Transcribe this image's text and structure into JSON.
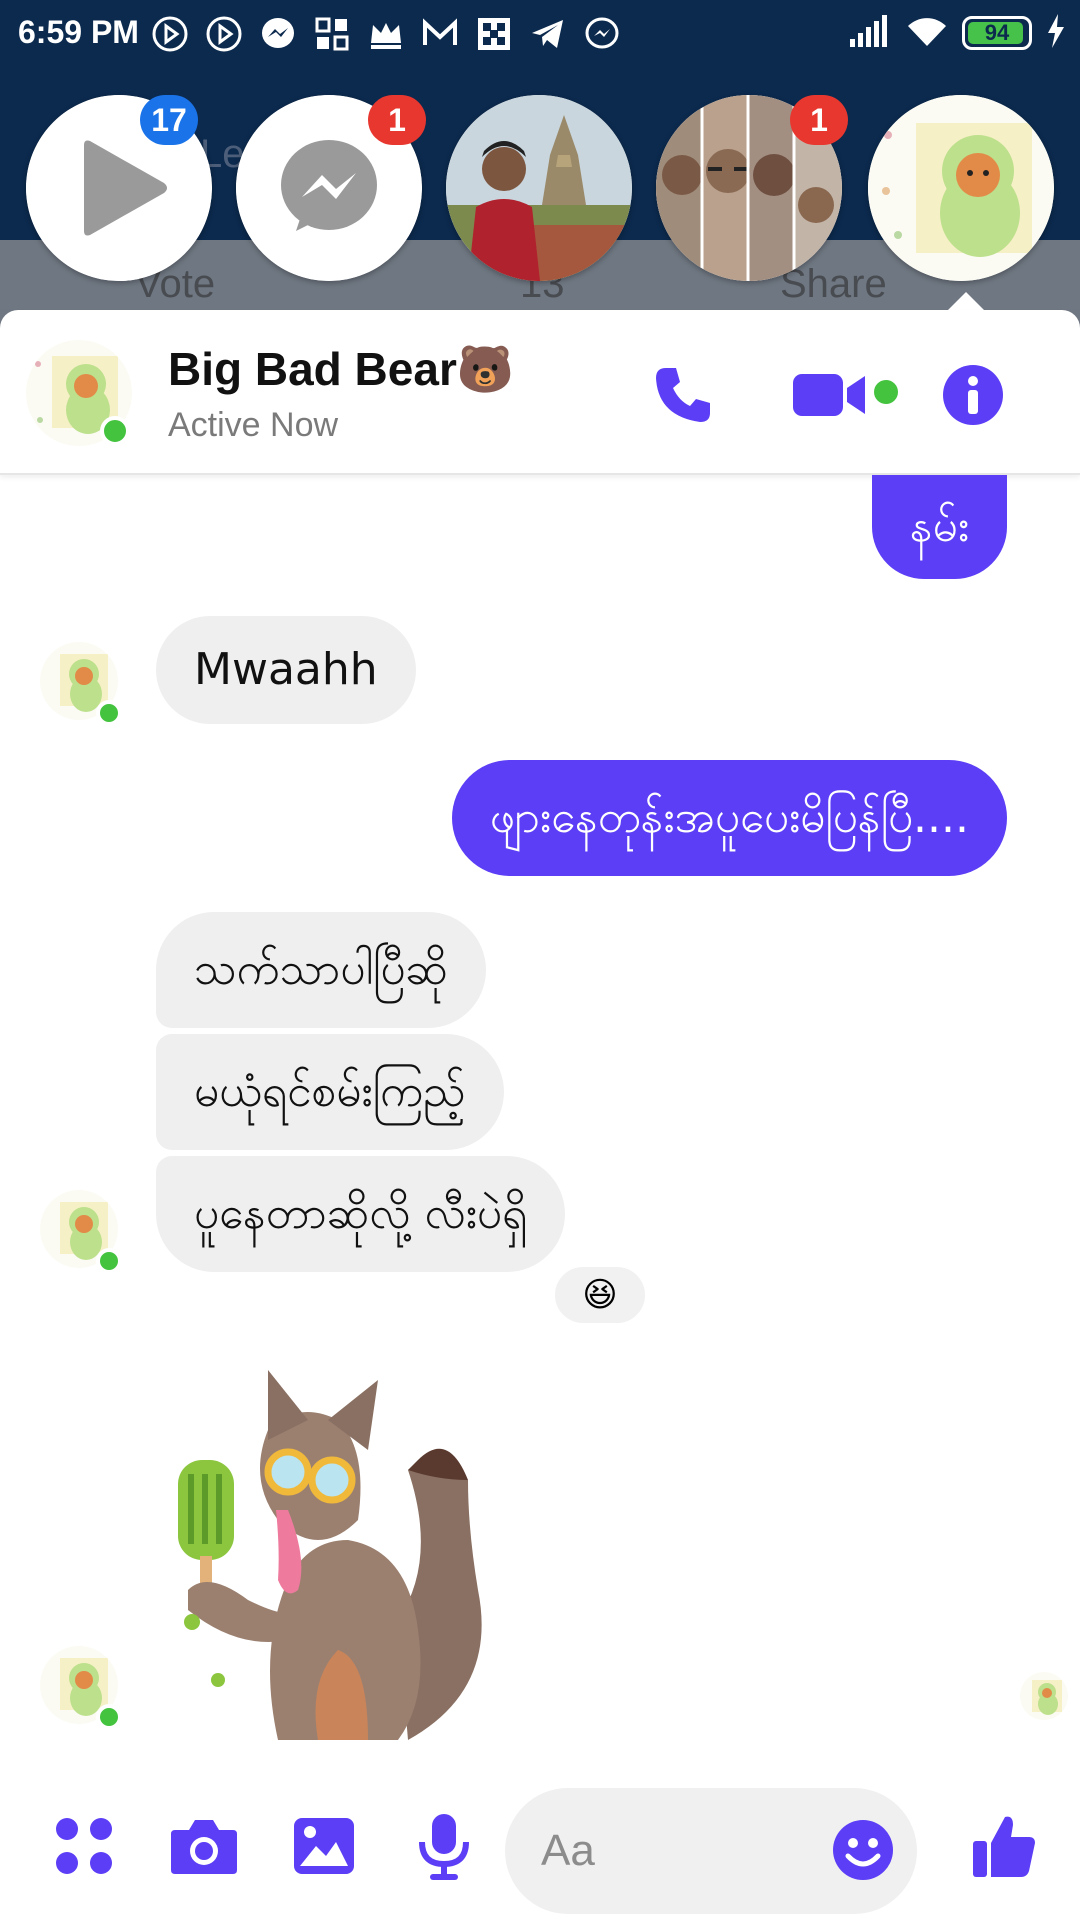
{
  "status_bar": {
    "time": "6:59 PM",
    "battery": "94",
    "battery_level": 0.94
  },
  "background_app": {
    "post_title": "Le",
    "vote_label": "Vote",
    "comment_count": "13",
    "share_label": "Share"
  },
  "chat_heads": [
    {
      "name": "video-player-head",
      "badge": "17",
      "badge_color": "#1a73e8"
    },
    {
      "name": "messenger-head",
      "badge": "1",
      "badge_color": "#e8372f"
    },
    {
      "name": "contact-pagoda-head",
      "badge": ""
    },
    {
      "name": "contact-group-head",
      "badge": "1",
      "badge_color": "#e8372f"
    },
    {
      "name": "big-bad-bear-head",
      "badge": ""
    }
  ],
  "conversation": {
    "contact_name": "Big Bad Bear🐻",
    "status": "Active Now"
  },
  "messages": [
    {
      "side": "out",
      "text": "နမ်း"
    },
    {
      "side": "in",
      "text": "Mwaahh"
    },
    {
      "side": "out",
      "text": "ဖျားနေတုန်းအပူပေးမိပြန်ပြီ...."
    },
    {
      "side": "in",
      "text": "သက်သာပါပြီဆို"
    },
    {
      "side": "in",
      "text": "မယုံရင်စမ်းကြည့်"
    },
    {
      "side": "in",
      "text": "ပူနေတာဆိုလို့ လီးပဲရှိ",
      "reaction": "😆"
    },
    {
      "side": "in",
      "type": "sticker",
      "sticker": "fox-popsicle-sticker"
    }
  ],
  "composer": {
    "placeholder": "Aa"
  },
  "colors": {
    "accent": "#5b3ef6",
    "online": "#44c33f",
    "incoming_bubble": "#efefef",
    "status_bar_bg": "#0c2a4e"
  }
}
